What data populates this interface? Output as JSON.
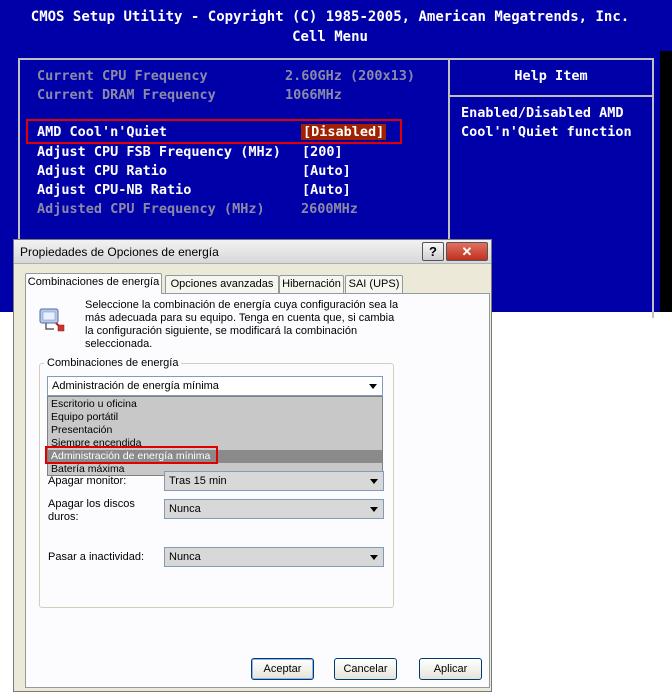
{
  "bios": {
    "title": "CMOS Setup Utility - Copyright (C) 1985-2005, American Megatrends, Inc.",
    "menu": "Cell Menu",
    "rows": [
      {
        "label": "Current CPU Frequency",
        "value": "2.60GHz (200x13)"
      },
      {
        "label": "Current DRAM Frequency",
        "value": "1066MHz"
      },
      {
        "label": "AMD Cool'n'Quiet",
        "value": "[Disabled]"
      },
      {
        "label": "Adjust CPU FSB Frequency (MHz)",
        "value": "[200]"
      },
      {
        "label": "Adjust CPU Ratio",
        "value": "[Auto]"
      },
      {
        "label": "Adjust CPU-NB Ratio",
        "value": "[Auto]"
      },
      {
        "label": "Adjusted CPU Frequency (MHz)",
        "value": "2600MHz"
      }
    ],
    "help_title": "Help Item",
    "help_lines": [
      "Enabled/Disabled AMD",
      "Cool'n'Quiet function"
    ],
    "colors": {
      "background": "#0000a8",
      "selected_value": "#a02000",
      "highlight_box": "#e00000"
    }
  },
  "dialog": {
    "title": "Propiedades de Opciones de energía",
    "help_button": "?",
    "close_button": "✕",
    "tabs": [
      "Combinaciones de energía",
      "Opciones avanzadas",
      "Hibernación",
      "SAI (UPS)"
    ],
    "intro": "Seleccione la combinación de energía  cuya configuración sea la más adecuada para su equipo. Tenga en cuenta que, si cambia la configuración siguiente, se modificará la combinación seleccionada.",
    "group_label": "Combinaciones de energía",
    "scheme_selected": "Administración de energía mínima",
    "scheme_options": [
      "Escritorio u oficina",
      "Equipo portátil",
      "Presentación",
      "Siempre encendida",
      "Administración de energía mínima",
      "Batería máxima"
    ],
    "fields": {
      "monitor_label": "Apagar monitor:",
      "monitor_value": "Tras 15 min",
      "disks_label": "Apagar los discos duros:",
      "disks_value": "Nunca",
      "standby_label": "Pasar a inactividad:",
      "standby_value": "Nunca"
    },
    "buttons": {
      "ok": "Aceptar",
      "cancel": "Cancelar",
      "apply": "Aplicar"
    }
  }
}
